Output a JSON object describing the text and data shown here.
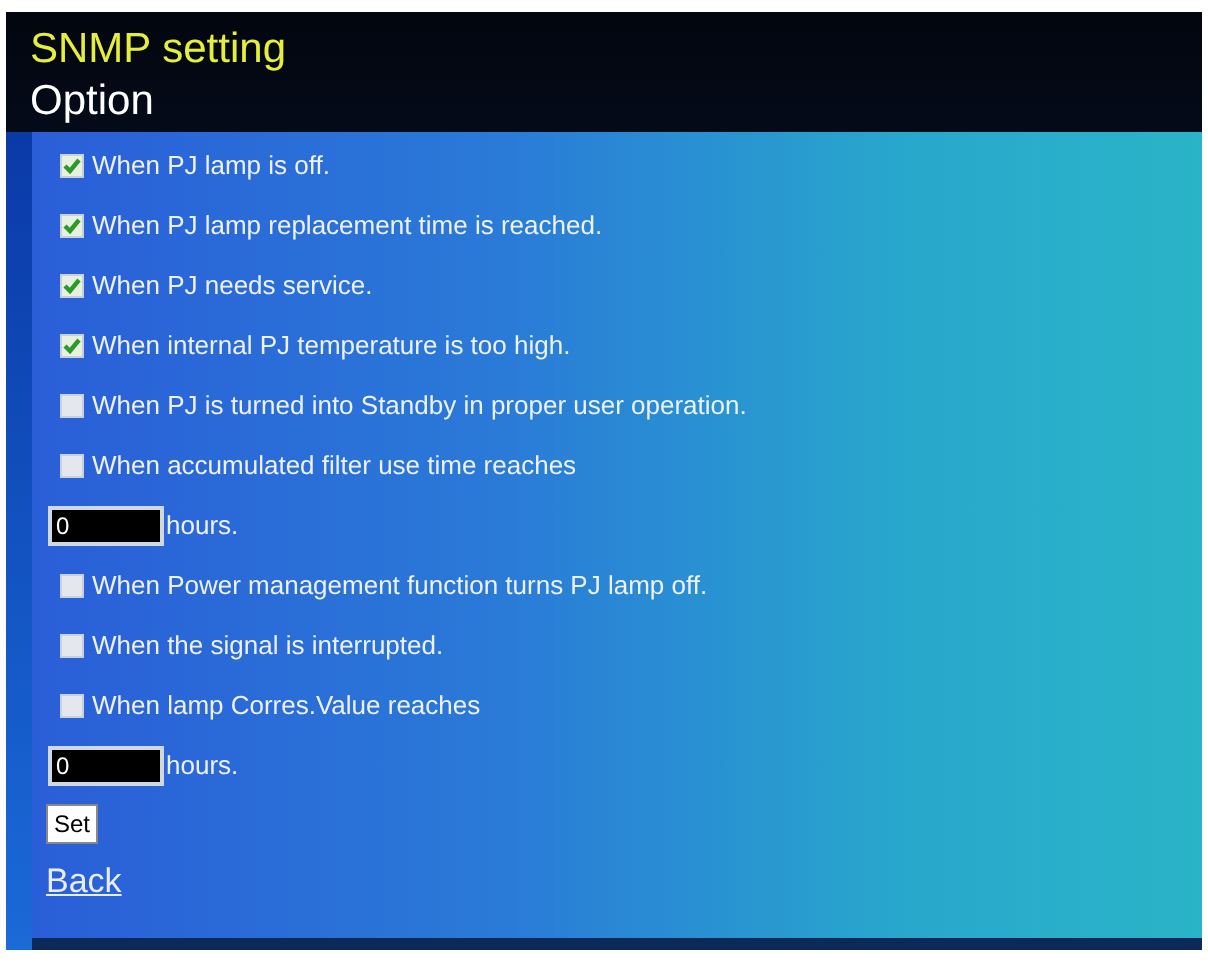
{
  "title": "SNMP setting",
  "subtitle": "Option",
  "items": [
    {
      "kind": "checkbox",
      "label": "When PJ lamp is off.",
      "checked": true
    },
    {
      "kind": "checkbox",
      "label": "When PJ lamp replacement time is reached.",
      "checked": true
    },
    {
      "kind": "checkbox",
      "label": "When PJ needs service.",
      "checked": true
    },
    {
      "kind": "checkbox",
      "label": "When internal PJ temperature is too high.",
      "checked": true
    },
    {
      "kind": "checkbox",
      "label": "When PJ is turned into Standby in proper user operation.",
      "checked": false
    },
    {
      "kind": "checkbox",
      "label": "When accumulated filter use time reaches",
      "checked": false
    },
    {
      "kind": "hours",
      "value": "0",
      "unit": "hours."
    },
    {
      "kind": "checkbox",
      "label": "When Power management function turns PJ lamp off.",
      "checked": false
    },
    {
      "kind": "checkbox",
      "label": "When the signal is interrupted.",
      "checked": false
    },
    {
      "kind": "checkbox",
      "label": "When lamp Corres.Value reaches",
      "checked": false
    },
    {
      "kind": "hours",
      "value": "0",
      "unit": "hours."
    }
  ],
  "set_button": "Set",
  "back_link": "Back"
}
